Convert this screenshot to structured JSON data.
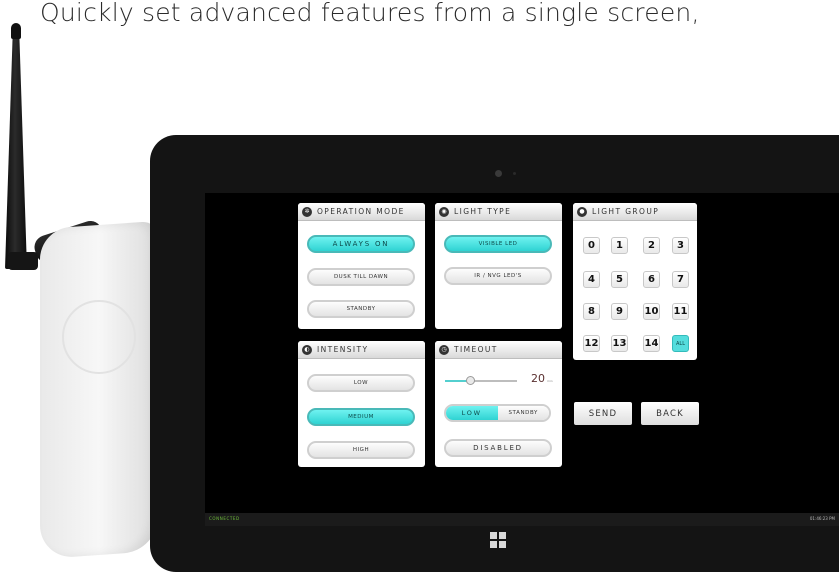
{
  "headline": "Quickly set advanced features from a single screen,",
  "operation_mode": {
    "title": "OPERATION MODE",
    "options": [
      "ALWAYS ON",
      "DUSK TILL DAWN",
      "STANDBY"
    ],
    "selected": "ALWAYS ON"
  },
  "light_type": {
    "title": "LIGHT TYPE",
    "options": [
      "VISIBLE LED",
      "IR / NVG LED'S"
    ],
    "selected": "VISIBLE LED"
  },
  "light_group": {
    "title": "LIGHT GROUP",
    "buttons": [
      "0",
      "1",
      "2",
      "3",
      "4",
      "5",
      "6",
      "7",
      "8",
      "9",
      "10",
      "11",
      "12",
      "13",
      "14",
      "ALL"
    ],
    "selected": "ALL"
  },
  "intensity": {
    "title": "INTENSITY",
    "options": [
      "LOW",
      "MEDIUM",
      "HIGH"
    ],
    "selected": "MEDIUM"
  },
  "timeout": {
    "title": "TIMEOUT",
    "value": "20",
    "unit": "min",
    "slider_fraction": 0.35,
    "toggle_options": [
      "LOW",
      "STANDBY"
    ],
    "toggle_selected": "LOW",
    "disabled_label": "DISABLED"
  },
  "actions": {
    "send": "SEND",
    "back": "BACK"
  },
  "taskbar": {
    "status": "CONNECTED",
    "clock": "01:46:23 PM"
  },
  "colors": {
    "accent": "#3fe0df",
    "screen": "#000000",
    "bezel": "#141414"
  }
}
